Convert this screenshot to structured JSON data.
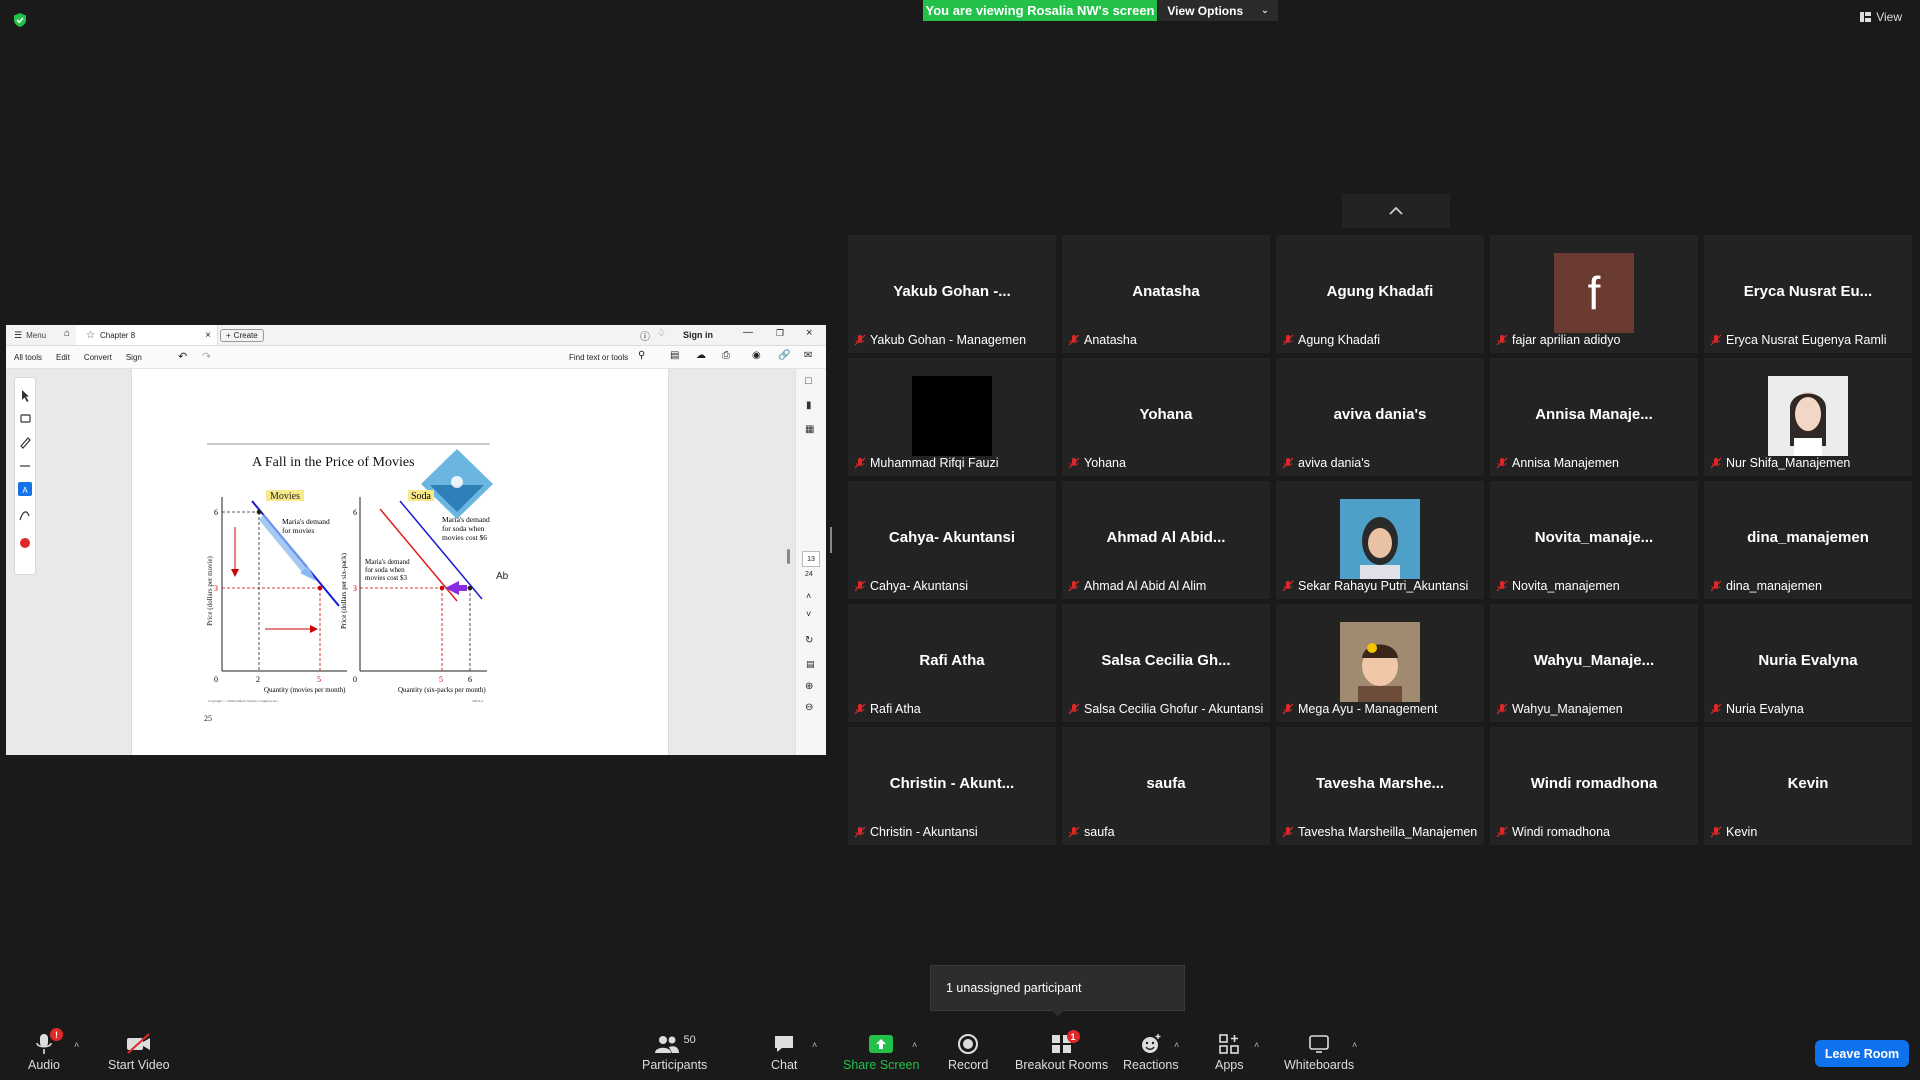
{
  "banner": {
    "viewing": "You are viewing Rosalia NW's screen",
    "view_options": "View Options",
    "top_view": "View"
  },
  "participants": [
    {
      "big": "Yakub Gohan -...",
      "label": "Yakub Gohan - Managemen"
    },
    {
      "big": "Anatasha",
      "label": "Anatasha"
    },
    {
      "big": "Agung Khadafi",
      "label": "Agung Khadafi"
    },
    {
      "big": "",
      "label": "fajar aprilian adidyo",
      "avatar_letter": "f"
    },
    {
      "big": "Eryca Nusrat Eu...",
      "label": "Eryca Nusrat Eugenya Ramli"
    },
    {
      "big": "",
      "label": "Muhammad Rifqi Fauzi"
    },
    {
      "big": "Yohana",
      "label": "Yohana"
    },
    {
      "big": "aviva dania's",
      "label": "aviva dania's"
    },
    {
      "big": "Annisa Manaje...",
      "label": "Annisa Manajemen"
    },
    {
      "big": "",
      "label": "Nur Shifa_Manajemen"
    },
    {
      "big": "Cahya- Akuntansi",
      "label": "Cahya- Akuntansi"
    },
    {
      "big": "Ahmad Al Abid...",
      "label": "Ahmad Al Abid Al Alim"
    },
    {
      "big": "",
      "label": "Sekar Rahayu Putri_Akuntansi"
    },
    {
      "big": "Novita_manaje...",
      "label": "Novita_manajemen"
    },
    {
      "big": "dina_manajemen",
      "label": "dina_manajemen"
    },
    {
      "big": "Rafi Atha",
      "label": "Rafi Atha"
    },
    {
      "big": "Salsa Cecilia Gh...",
      "label": "Salsa Cecilia Ghofur - Akuntansi"
    },
    {
      "big": "",
      "label": "Mega Ayu - Management"
    },
    {
      "big": "Wahyu_Manaje...",
      "label": "Wahyu_Manajemen"
    },
    {
      "big": "Nuria Evalyna",
      "label": "Nuria Evalyna"
    },
    {
      "big": "Christin - Akunt...",
      "label": "Christin - Akuntansi"
    },
    {
      "big": "saufa",
      "label": "saufa"
    },
    {
      "big": "Tavesha Marshe...",
      "label": "Tavesha Marsheilla_Manajemen"
    },
    {
      "big": "Windi romadhona",
      "label": "Windi romadhona"
    },
    {
      "big": "Kevin",
      "label": "Kevin"
    }
  ],
  "acrobat": {
    "menu": "Menu",
    "tab": "Chapter 8",
    "create": "Create",
    "sign_in": "Sign in",
    "tools": [
      "All tools",
      "Edit",
      "Convert",
      "Sign"
    ],
    "find": "Find text or tools",
    "page_current": "13",
    "page_total": "24"
  },
  "slide": {
    "title": "A Fall in the Price of Movies",
    "left_panel": "Movies",
    "right_panel": "Soda",
    "left_ylabel": "Price (dollars per movie)",
    "right_ylabel": "Price (dollars per six-pack)",
    "left_xlabel": "Quantity (movies per month)",
    "right_xlabel": "Quantity (six-packs per month)",
    "left_demand": [
      "Maria's demand",
      "for movies"
    ],
    "soda_demand_3": [
      "Maria's demand",
      "for soda when",
      "movies cost $3"
    ],
    "soda_demand_6": [
      "Maria's demand",
      "for soda when",
      "movies cost $6"
    ],
    "copyright": "Copyright © 1998 Addison Wesley Longman, Inc.",
    "fig": "TM 8-4",
    "page_number": "25",
    "cursor_text": "Ab",
    "ticks": {
      "six": "6",
      "three": "3",
      "zero": "0",
      "two": "2",
      "five": "5"
    }
  },
  "popup": {
    "unassigned": "1 unassigned participant"
  },
  "toolbar": {
    "audio": "Audio",
    "start_video": "Start Video",
    "participants": "Participants",
    "participants_count": "50",
    "chat": "Chat",
    "share_screen": "Share Screen",
    "record": "Record",
    "breakout_rooms": "Breakout Rooms",
    "breakout_badge": "1",
    "audio_badge": "!",
    "reactions": "Reactions",
    "apps": "Apps",
    "whiteboards": "Whiteboards",
    "leave": "Leave Room"
  }
}
